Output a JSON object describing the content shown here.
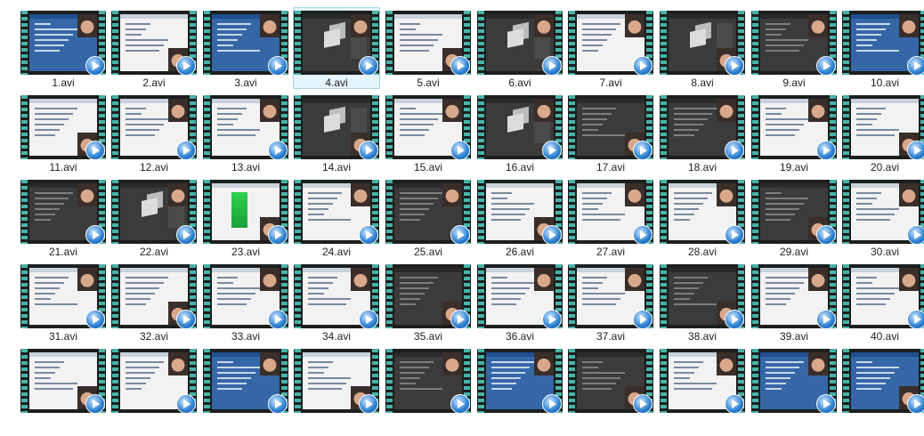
{
  "view": {
    "selected_index": 3
  },
  "files": [
    {
      "name": "1.avi",
      "thumb": "blue"
    },
    {
      "name": "2.avi",
      "thumb": "light"
    },
    {
      "name": "3.avi",
      "thumb": "blue"
    },
    {
      "name": "4.avi",
      "thumb": "dark-cube"
    },
    {
      "name": "5.avi",
      "thumb": "light"
    },
    {
      "name": "6.avi",
      "thumb": "dark-cube"
    },
    {
      "name": "7.avi",
      "thumb": "light"
    },
    {
      "name": "8.avi",
      "thumb": "dark-cube"
    },
    {
      "name": "9.avi",
      "thumb": "dark"
    },
    {
      "name": "10.avi",
      "thumb": "blue"
    },
    {
      "name": "11.avi",
      "thumb": "light"
    },
    {
      "name": "12.avi",
      "thumb": "light"
    },
    {
      "name": "13.avi",
      "thumb": "light"
    },
    {
      "name": "14.avi",
      "thumb": "dark-cube"
    },
    {
      "name": "15.avi",
      "thumb": "light"
    },
    {
      "name": "16.avi",
      "thumb": "dark-cube"
    },
    {
      "name": "17.avi",
      "thumb": "dark"
    },
    {
      "name": "18.avi",
      "thumb": "dark"
    },
    {
      "name": "19.avi",
      "thumb": "light"
    },
    {
      "name": "20.avi",
      "thumb": "light"
    },
    {
      "name": "21.avi",
      "thumb": "dark"
    },
    {
      "name": "22.avi",
      "thumb": "dark-cube"
    },
    {
      "name": "23.avi",
      "thumb": "green"
    },
    {
      "name": "24.avi",
      "thumb": "light"
    },
    {
      "name": "25.avi",
      "thumb": "dark"
    },
    {
      "name": "26.avi",
      "thumb": "light"
    },
    {
      "name": "27.avi",
      "thumb": "light"
    },
    {
      "name": "28.avi",
      "thumb": "light"
    },
    {
      "name": "29.avi",
      "thumb": "dark"
    },
    {
      "name": "30.avi",
      "thumb": "light"
    },
    {
      "name": "31.avi",
      "thumb": "light"
    },
    {
      "name": "32.avi",
      "thumb": "light"
    },
    {
      "name": "33.avi",
      "thumb": "light"
    },
    {
      "name": "34.avi",
      "thumb": "light"
    },
    {
      "name": "35.avi",
      "thumb": "dark"
    },
    {
      "name": "36.avi",
      "thumb": "light"
    },
    {
      "name": "37.avi",
      "thumb": "light"
    },
    {
      "name": "38.avi",
      "thumb": "dark"
    },
    {
      "name": "39.avi",
      "thumb": "light"
    },
    {
      "name": "40.avi",
      "thumb": "light"
    },
    {
      "name": "",
      "thumb": "light"
    },
    {
      "name": "",
      "thumb": "light"
    },
    {
      "name": "",
      "thumb": "blue"
    },
    {
      "name": "",
      "thumb": "light"
    },
    {
      "name": "",
      "thumb": "dark"
    },
    {
      "name": "",
      "thumb": "blue"
    },
    {
      "name": "",
      "thumb": "dark"
    },
    {
      "name": "",
      "thumb": "light"
    },
    {
      "name": "",
      "thumb": "blue"
    },
    {
      "name": "",
      "thumb": "blue"
    }
  ]
}
